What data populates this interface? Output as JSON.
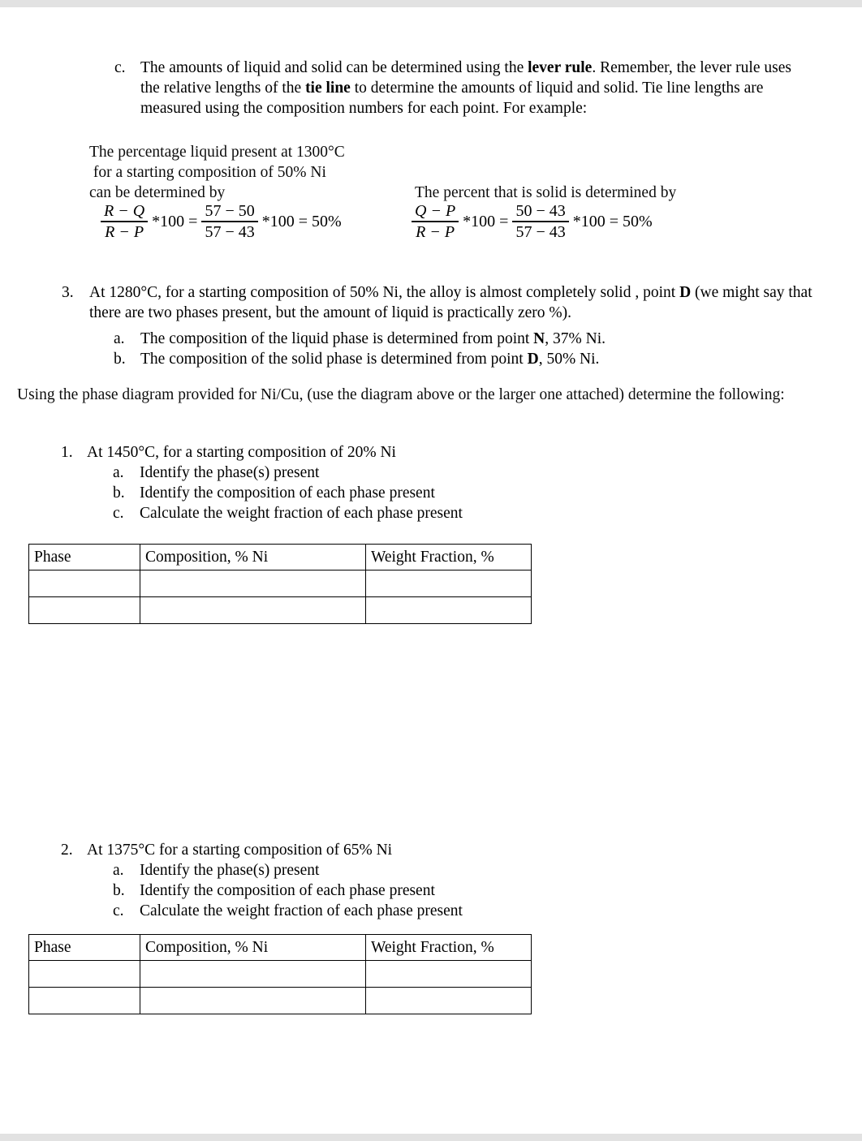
{
  "document": {
    "item_c": {
      "marker": "c.",
      "segments": [
        {
          "t": "The amounts of liquid and solid can be determined using the ",
          "b": false
        },
        {
          "t": "lever rule",
          "b": true
        },
        {
          "t": ". Remember, the lever rule uses the relative lengths of the ",
          "b": false
        },
        {
          "t": "tie line",
          "b": true
        },
        {
          "t": " to determine the amounts of liquid and solid. Tie line lengths are measured using the composition numbers for each point. For example:",
          "b": false
        }
      ],
      "full_text": "The amounts of liquid and solid can be determined using the lever rule. Remember, the lever rule uses the relative lengths of the tie line to determine the amounts of liquid and solid. Tie line lengths are measured using the composition numbers for each point. For example:"
    },
    "liquid_example": {
      "line1": "The percentage liquid present at 1300°C",
      "line2": " for a starting composition of 50% Ni",
      "line3": "can be determined by",
      "equation": {
        "frac1_num": "R − Q",
        "frac1_den": "R − P",
        "op1": "*100 =",
        "frac2_num": "57 − 50",
        "frac2_den": "57 − 43",
        "op2": "*100 = 50%"
      }
    },
    "solid_example": {
      "line1": "The percent that is solid is determined by",
      "equation": {
        "frac1_num": "Q − P",
        "frac1_den": "R − P",
        "op1": "*100 =",
        "frac2_num": "50 − 43",
        "frac2_den": "57 − 43",
        "op2": "*100 = 50%"
      }
    },
    "item_3": {
      "marker": "3.",
      "segments": [
        {
          "t": "At 1280°C, for a starting composition of 50% Ni, the alloy is almost completely solid , point ",
          "b": false
        },
        {
          "t": "D",
          "b": true
        },
        {
          "t": " (we might say that there are two phases present, but the amount of liquid is practically zero %).",
          "b": false
        }
      ],
      "full_text": "At 1280°C, for a starting composition of 50% Ni, the alloy is almost completely solid , point D (we might say that there are two phases present, but the amount of liquid is practically zero %).",
      "sub_a": {
        "marker": "a.",
        "segments": [
          {
            "t": "The composition of the liquid phase is determined from point ",
            "b": false
          },
          {
            "t": "N",
            "b": true
          },
          {
            "t": ", 37% Ni.",
            "b": false
          }
        ],
        "full_text": "The composition of the liquid phase is determined from point N, 37% Ni."
      },
      "sub_b": {
        "marker": "b.",
        "segments": [
          {
            "t": "The composition of the solid phase is determined from point ",
            "b": false
          },
          {
            "t": "D",
            "b": true
          },
          {
            "t": ", 50% Ni.",
            "b": false
          }
        ],
        "full_text": "The composition of the solid phase is determined from point D, 50% Ni."
      }
    },
    "intro_paragraph": "Using the phase diagram provided for Ni/Cu, (use the diagram above or the larger one attached) determine the following:",
    "question_1": {
      "marker": "1.",
      "stem": "At 1450°C, for a starting composition of 20% Ni",
      "subs": [
        {
          "marker": "a.",
          "text": "Identify the phase(s) present"
        },
        {
          "marker": "b.",
          "text": "Identify the composition of each phase present"
        },
        {
          "marker": "c.",
          "text": "Calculate the weight fraction of each phase present"
        }
      ]
    },
    "question_2": {
      "marker": "2.",
      "stem": "At 1375°C for a starting composition of 65% Ni",
      "subs": [
        {
          "marker": "a.",
          "text": "Identify the phase(s) present"
        },
        {
          "marker": "b.",
          "text": "Identify the composition of each phase present"
        },
        {
          "marker": "c.",
          "text": "Calculate the weight fraction of each phase present"
        }
      ]
    },
    "table_1": {
      "headers": [
        "Phase",
        "Composition, % Ni",
        "Weight Fraction, %"
      ],
      "rows": [
        [
          "",
          "",
          ""
        ],
        [
          "",
          "",
          ""
        ]
      ]
    },
    "table_2": {
      "headers": [
        "Phase",
        "Composition, % Ni",
        "Weight Fraction, %"
      ],
      "rows": [
        [
          "",
          "",
          ""
        ],
        [
          "",
          "",
          ""
        ]
      ]
    }
  },
  "colors": {
    "page_background": "#ffffff",
    "edge_band": "#e2e2e2",
    "text": "#0d0d0d",
    "table_border": "#000000"
  }
}
